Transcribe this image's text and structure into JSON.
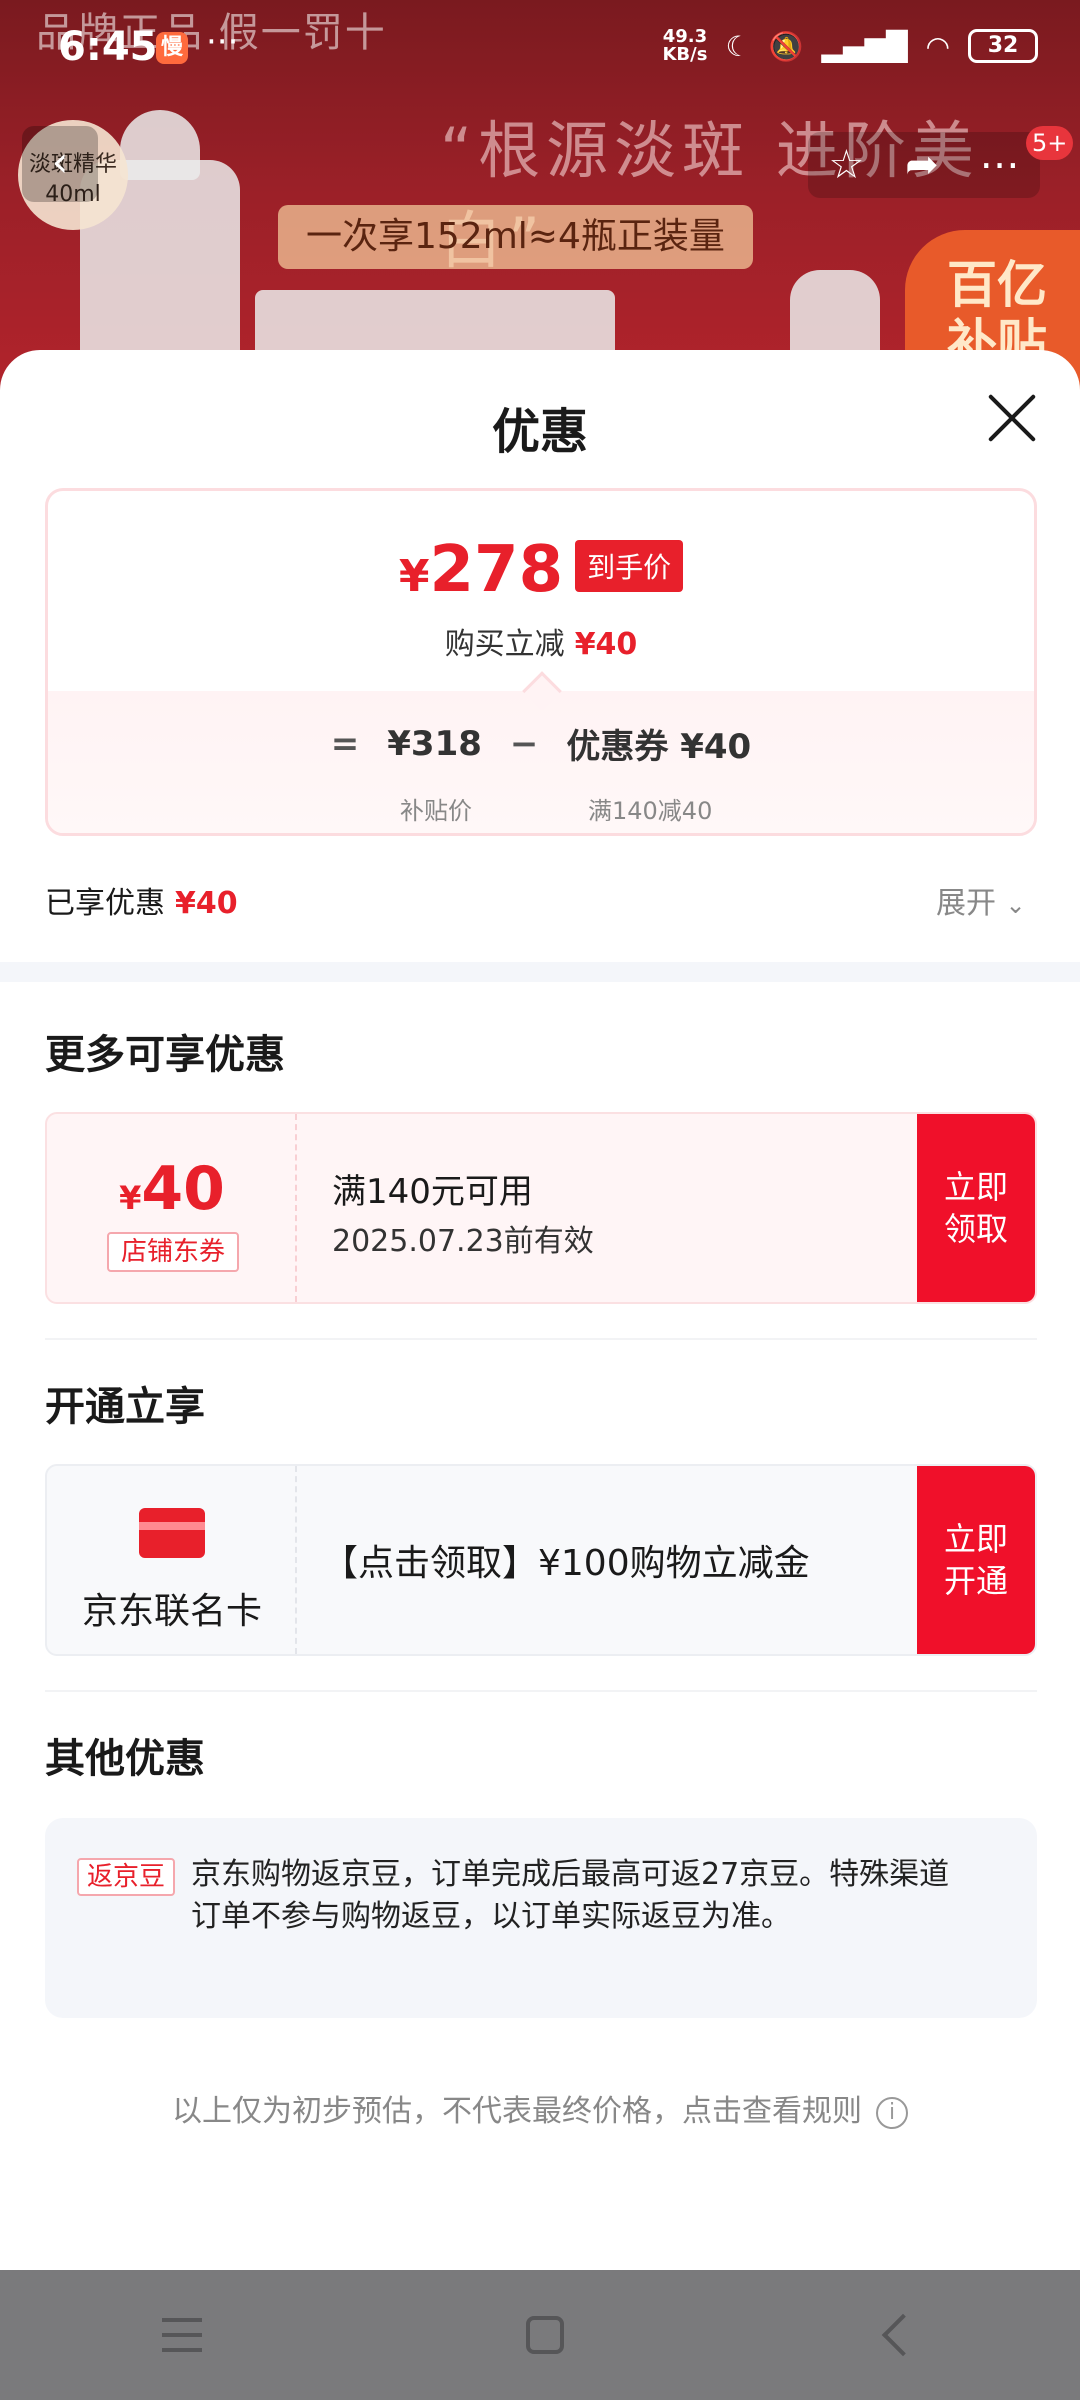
{
  "status_bar": {
    "time": "6:45",
    "app_badge": "慢",
    "more": "···",
    "net_speed_value": "49.3",
    "net_speed_unit": "KB/s",
    "battery": "32"
  },
  "banner": {
    "watermark": "品牌正品 假一罚十",
    "slogan": "“根源淡斑 进阶美白”",
    "subslogan": "一次享152ml≈4瓶正装量",
    "badge_line1": "淡斑精华",
    "badge_line2": "40ml",
    "baiyi_line1": "百亿",
    "baiyi_line2": "补贴",
    "notification_count": "5+"
  },
  "sheet": {
    "title": "优惠",
    "price": {
      "currency": "¥",
      "final_price": "278",
      "final_tag": "到手价",
      "reduce_label": "购买立减",
      "reduce_value": "¥40",
      "equals": "=",
      "subsidy_price": "¥318",
      "minus": "−",
      "coupon_label": "优惠券 ¥40",
      "subsidy_caption": "补贴价",
      "coupon_caption": "满140减40"
    },
    "enjoyed_label": "已享优惠",
    "enjoyed_value": "¥40",
    "expand_label": "展开",
    "more_offers_title": "更多可享优惠",
    "coupon": {
      "currency": "¥",
      "amount": "40",
      "kind": "店铺东券",
      "condition": "满140元可用",
      "validity": "2025.07.23前有效",
      "button_line1": "立即",
      "button_line2": "领取"
    },
    "open_title": "开通立享",
    "card": {
      "name": "京东联名卡",
      "promo": "【点击领取】¥100购物立减金",
      "button_line1": "立即",
      "button_line2": "开通"
    },
    "other_title": "其他优惠",
    "other": {
      "tag": "返京豆",
      "text": "京东购物返京豆，订单完成后最高可返27京豆。特殊渠道订单不参与购物返豆，以订单实际返豆为准。"
    },
    "disclaimer": "以上仅为初步预估，不代表最终价格，点击查看规则"
  },
  "colors": {
    "accent": "#e8202b",
    "button_red": "#f0102a"
  }
}
